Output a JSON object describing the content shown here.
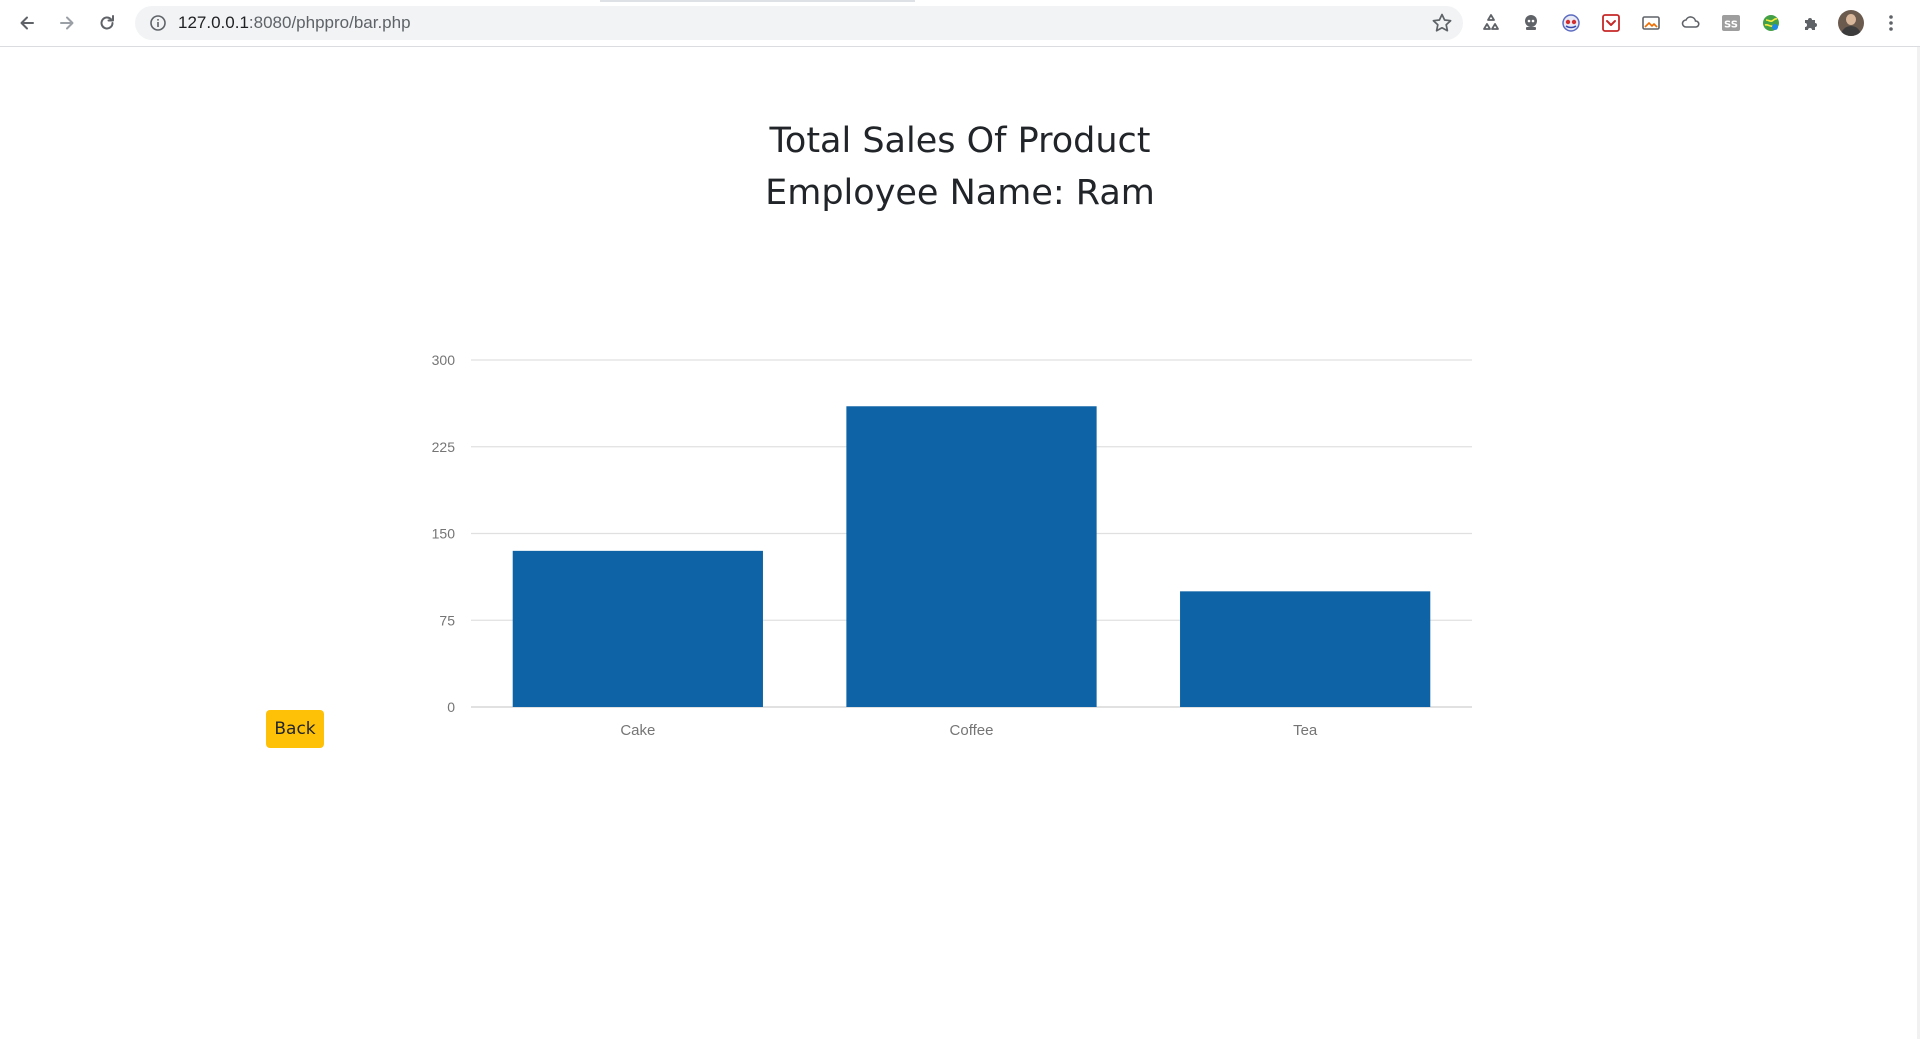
{
  "browser": {
    "url_host": "127.0.0.1",
    "url_rest": ":8080/phppro/bar.php",
    "icons": {
      "back": "arrow-left-icon",
      "forward": "arrow-right-icon",
      "reload": "reload-icon",
      "info": "info-icon",
      "bookmark": "star-icon",
      "menu": "kebab-menu-icon"
    },
    "extensions": [
      "recycle-icon",
      "mask-icon",
      "eyes-icon",
      "pocket-icon",
      "picture-icon",
      "cloud-icon",
      "ss-icon",
      "globe-icon",
      "puzzle-icon"
    ]
  },
  "page": {
    "title_line1": "Total Sales Of Product",
    "title_line2": "Employee Name: Ram",
    "back_label": "Back"
  },
  "colors": {
    "bar": "#0d63a5",
    "back_button": "#ffc107",
    "grid": "#e0e0e0",
    "tick_text": "#757575"
  },
  "chart_data": {
    "type": "bar",
    "categories": [
      "Cake",
      "Coffee",
      "Tea"
    ],
    "values": [
      135,
      260,
      100
    ],
    "title": "",
    "xlabel": "",
    "ylabel": "",
    "ylim": [
      0,
      300
    ],
    "yticks": [
      0,
      75,
      150,
      225,
      300
    ],
    "grid": true,
    "legend": "none"
  }
}
